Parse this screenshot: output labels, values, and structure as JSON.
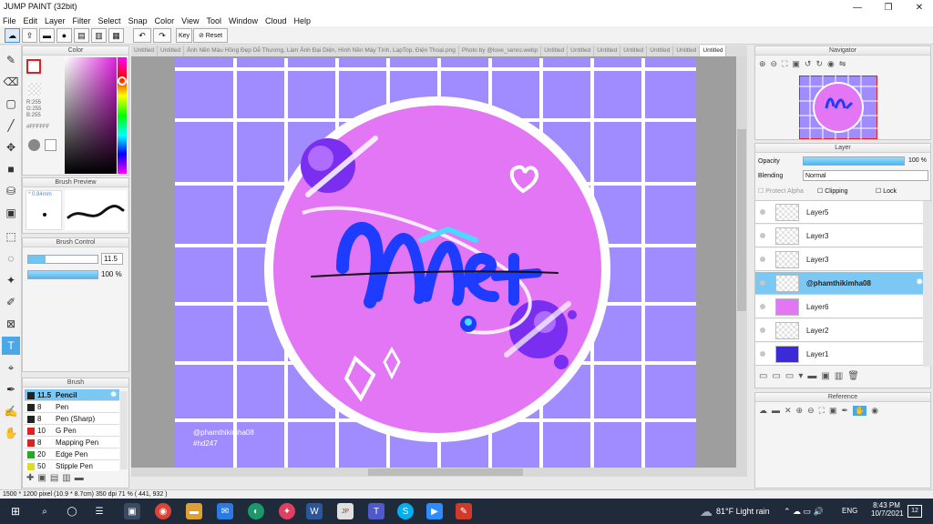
{
  "app": {
    "title": "JUMP PAINT (32bit)"
  },
  "menu": [
    "File",
    "Edit",
    "Layer",
    "Filter",
    "Select",
    "Snap",
    "Color",
    "View",
    "Tool",
    "Window",
    "Cloud",
    "Help"
  ],
  "toolbar": {
    "key_label": "Key",
    "reset_label": "Reset"
  },
  "tabs": [
    "Untitled",
    "Untitled",
    "Ảnh Nền Màu Hồng Đẹp Dễ Thương, Làm Ảnh Đại Diện, Hình Nền Máy Tính, LapTop, Điện Thoại.png",
    "Photo by @love_senro.webp",
    "Untitled",
    "Untitled",
    "Untitled",
    "Untitled",
    "Untitled",
    "Untitled",
    "Untitled"
  ],
  "color_panel": {
    "title": "Color",
    "r": "R:255",
    "g": "G:255",
    "b": "B:255",
    "hex": "#FFFFFF"
  },
  "brush_preview": {
    "title": "Brush Preview",
    "size": "0.84mm"
  },
  "brush_control": {
    "title": "Brush Control",
    "size_value": "11.5",
    "opacity_value": "100 %"
  },
  "brush_panel": {
    "title": "Brush",
    "items": [
      {
        "size": "11.5",
        "name": "Pencil",
        "color": "#222222"
      },
      {
        "size": "8",
        "name": "Pen",
        "color": "#222222"
      },
      {
        "size": "8",
        "name": "Pen (Sharp)",
        "color": "#222222"
      },
      {
        "size": "10",
        "name": "G Pen",
        "color": "#dd2222"
      },
      {
        "size": "8",
        "name": "Mapping Pen",
        "color": "#dd2222"
      },
      {
        "size": "20",
        "name": "Edge Pen",
        "color": "#22aa22"
      },
      {
        "size": "50",
        "name": "Stipple Pen",
        "color": "#dddd22"
      }
    ]
  },
  "artwork": {
    "signature": "@phamthikimha08",
    "hashtag": "#hd247"
  },
  "navigator": {
    "title": "Navigator"
  },
  "layer_panel": {
    "title": "Layer",
    "opacity_label": "Opacity",
    "opacity_value": "100 %",
    "blending_label": "Blending",
    "blending_value": "Normal",
    "protect_alpha": "Protect Alpha",
    "clipping": "Clipping",
    "lock": "Lock",
    "layers": [
      "Layer5",
      "Layer3",
      "Layer3",
      "@phamthikimha08",
      "Layer6",
      "Layer2",
      "Layer1"
    ],
    "selected_index": 3
  },
  "reference": {
    "title": "Reference"
  },
  "status": {
    "text": "1500 * 1200 pixel  (10.9 * 8.7cm)  350 dpi  71 %  ( 441, 932 )"
  },
  "taskbar": {
    "weather": "81°F  Light rain",
    "lang": "ENG",
    "time": "8:43 PM",
    "date": "10/7/2021",
    "notif": "12"
  },
  "colors": {
    "accent": "#6cc6f5",
    "canvas_bg": "#a18cff",
    "circle": "#e276f5",
    "selected_layer": "#7cc8f4"
  }
}
